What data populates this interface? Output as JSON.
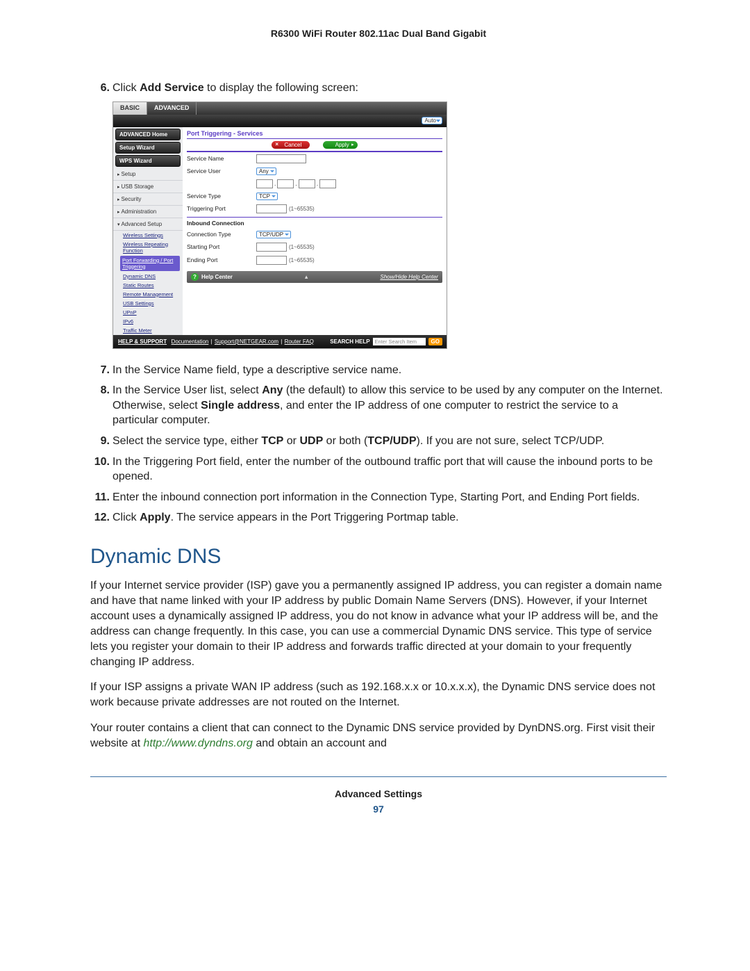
{
  "header_title": "R6300 WiFi Router 802.11ac Dual Band Gigabit",
  "steps": {
    "s6_pre": "Click ",
    "s6_b": "Add Service",
    "s6_post": " to display the following screen:",
    "s7": "In the Service Name field, type a descriptive service name.",
    "s8_a": "In the Service User list, select ",
    "s8_b1": "Any",
    "s8_c": " (the default) to allow this service to be used by any computer on the Internet. Otherwise, select ",
    "s8_b2": "Single address",
    "s8_d": ", and enter the IP address of one computer to restrict the service to a particular computer.",
    "s9_a": "Select the service type, either ",
    "s9_b1": "TCP",
    "s9_c": " or ",
    "s9_b2": "UDP",
    "s9_d": " or both (",
    "s9_b3": "TCP/UDP",
    "s9_e": "). If you are not sure, select TCP/UDP.",
    "s10": "In the Triggering Port field, enter the number of the outbound traffic port that will cause the inbound ports to be opened.",
    "s11": "Enter the inbound connection port information in the Connection Type, Starting Port, and Ending Port fields.",
    "s12_a": "Click ",
    "s12_b": "Apply",
    "s12_c": ". The service appears in the Port Triggering Portmap table."
  },
  "shot": {
    "auto": "Auto",
    "tab_basic": "BASIC",
    "tab_adv": "ADVANCED",
    "side": {
      "adv_home": "ADVANCED Home",
      "setup_wiz": "Setup Wizard",
      "wps_wiz": "WPS Wizard",
      "setup": "Setup",
      "usb": "USB Storage",
      "security": "Security",
      "admin": "Administration",
      "adv_setup": "Advanced Setup",
      "subs": {
        "ws": "Wireless Settings",
        "wrf": "Wireless Repeating Function",
        "pf": "Port Forwarding / Port Triggering",
        "ddns": "Dynamic DNS",
        "sr": "Static Routes",
        "rm": "Remote Management",
        "usb": "USB Settings",
        "upnp": "UPnP",
        "ipv6": "IPv6",
        "tm": "Traffic Meter"
      }
    },
    "main": {
      "title": "Port Triggering - Services",
      "cancel": "Cancel",
      "apply": "Apply",
      "service_name": "Service Name",
      "service_user": "Service User",
      "service_user_val": "Any",
      "service_type": "Service Type",
      "service_type_val": "TCP",
      "triggering_port": "Triggering Port",
      "range": "(1~65535)",
      "inbound": "Inbound Connection",
      "conn_type": "Connection Type",
      "conn_type_val": "TCP/UDP",
      "start_port": "Starting Port",
      "end_port": "Ending Port"
    },
    "help": {
      "label": "Help Center",
      "showhide": "Show/Hide Help Center"
    },
    "foot": {
      "hs": "HELP & SUPPORT",
      "doc": "Documentation",
      "sup": "Support@NETGEAR.com",
      "faq": "Router FAQ",
      "search_label": "SEARCH HELP",
      "search_ph": "Enter Search Item",
      "go": "GO"
    }
  },
  "section_title": "Dynamic DNS",
  "para1": "If your Internet service provider (ISP) gave you a permanently assigned IP address, you can register a domain name and have that name linked with your IP address by public Domain Name Servers (DNS). However, if your Internet account uses a dynamically assigned IP address, you do not know in advance what your IP address will be, and the address can change frequently. In this case, you can use a commercial Dynamic DNS service. This type of service lets you register your domain to their IP address and forwards traffic directed at your domain to your frequently changing IP address.",
  "para2": "If your ISP assigns a private WAN IP address (such as 192.168.x.x or 10.x.x.x), the Dynamic DNS service does not work because private addresses are not routed on the Internet.",
  "para3_a": "Your router contains a client that can connect to the Dynamic DNS service provided by DynDNS.org. First visit their website at ",
  "para3_link": "http://www.dyndns.org",
  "para3_b": " and obtain an account and",
  "footer_title": "Advanced Settings",
  "footer_page": "97"
}
